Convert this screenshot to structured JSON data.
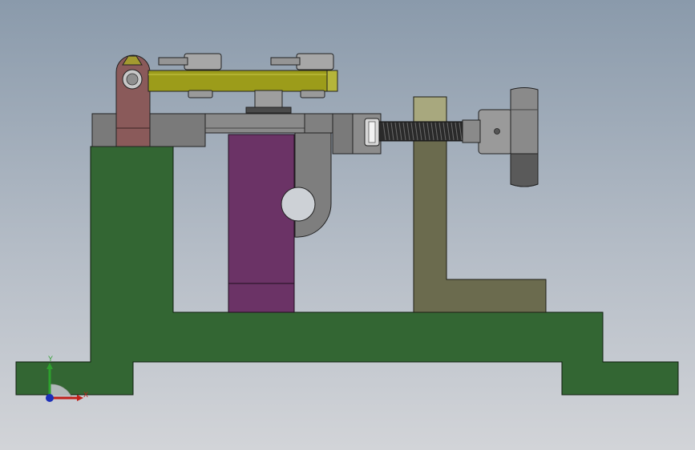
{
  "viewport": {
    "background_top": "#8a9aab",
    "background_bottom": "#d2d4d8"
  },
  "triad": {
    "x_label": "X",
    "y_label": "Y",
    "x_color": "#c0201a",
    "y_color": "#2ea02e",
    "z_color": "#1c2fb8"
  },
  "parts": {
    "base_frame": {
      "color": "#336633"
    },
    "support_block": {
      "color": "#6b3366"
    },
    "l_bracket": {
      "color": "#6b6b4e"
    },
    "top_clamp_bar": {
      "color": "#9c9c1a"
    },
    "hinge_link": {
      "color": "#8a5a5a"
    },
    "guide_rail": {
      "color": "#7e7e7e"
    },
    "hand_knob": {
      "color": "#8a8a8a"
    },
    "lead_screw": {
      "color": "#2a2a2a"
    }
  }
}
